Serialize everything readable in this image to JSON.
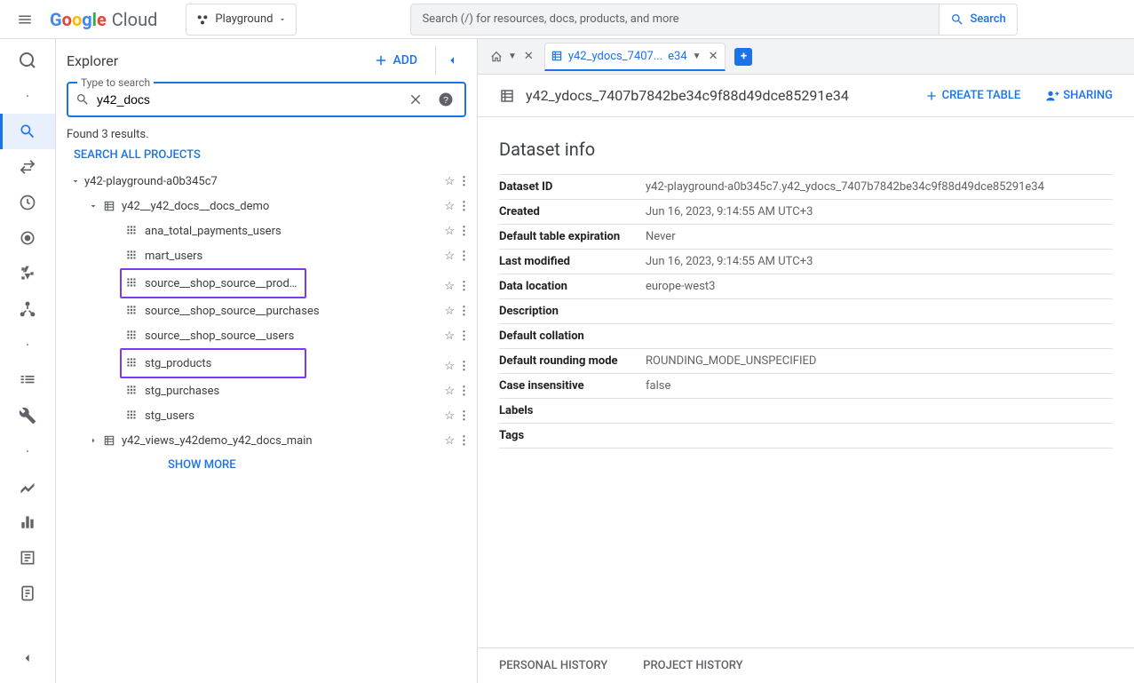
{
  "topbar": {
    "logo_cloud": "Cloud",
    "project_label": "Playground",
    "search_placeholder": "Search (/) for resources, docs, products, and more",
    "search_button": "Search"
  },
  "explorer": {
    "title": "Explorer",
    "add_label": "ADD",
    "search_label": "Type to search",
    "search_value": "y42_docs",
    "results_text": "Found 3 results.",
    "search_all": "SEARCH ALL PROJECTS",
    "show_more": "SHOW MORE",
    "tree": {
      "project": "y42-playground-a0b345c7",
      "dataset1": "y42__y42_docs__docs_demo",
      "dataset1_tables": [
        "ana_total_payments_users",
        "mart_users",
        "source__shop_source__products",
        "source__shop_source__purchases",
        "source__shop_source__users",
        "stg_products",
        "stg_purchases",
        "stg_users"
      ],
      "dataset2": "y42_views_y42demo_y42_docs_main"
    }
  },
  "tabs": {
    "active_label": "y42_ydocs_7407...",
    "active_suffix": "e34"
  },
  "dataset": {
    "title": "y42_ydocs_7407b7842be34c9f88d49dce85291e34",
    "create_table": "CREATE TABLE",
    "sharing": "SHARING",
    "info_heading": "Dataset info",
    "rows": {
      "dataset_id_label": "Dataset ID",
      "dataset_id_value": "y42-playground-a0b345c7.y42_ydocs_7407b7842be34c9f88d49dce85291e34",
      "created_label": "Created",
      "created_value": "Jun 16, 2023, 9:14:55 AM UTC+3",
      "expiration_label": "Default table expiration",
      "expiration_value": "Never",
      "modified_label": "Last modified",
      "modified_value": "Jun 16, 2023, 9:14:55 AM UTC+3",
      "location_label": "Data location",
      "location_value": "europe-west3",
      "description_label": "Description",
      "description_value": "",
      "collation_label": "Default collation",
      "collation_value": "",
      "rounding_label": "Default rounding mode",
      "rounding_value": "ROUNDING_MODE_UNSPECIFIED",
      "case_label": "Case insensitive",
      "case_value": "false",
      "labels_label": "Labels",
      "labels_value": "",
      "tags_label": "Tags",
      "tags_value": ""
    }
  },
  "footer": {
    "personal": "PERSONAL HISTORY",
    "project": "PROJECT HISTORY"
  }
}
